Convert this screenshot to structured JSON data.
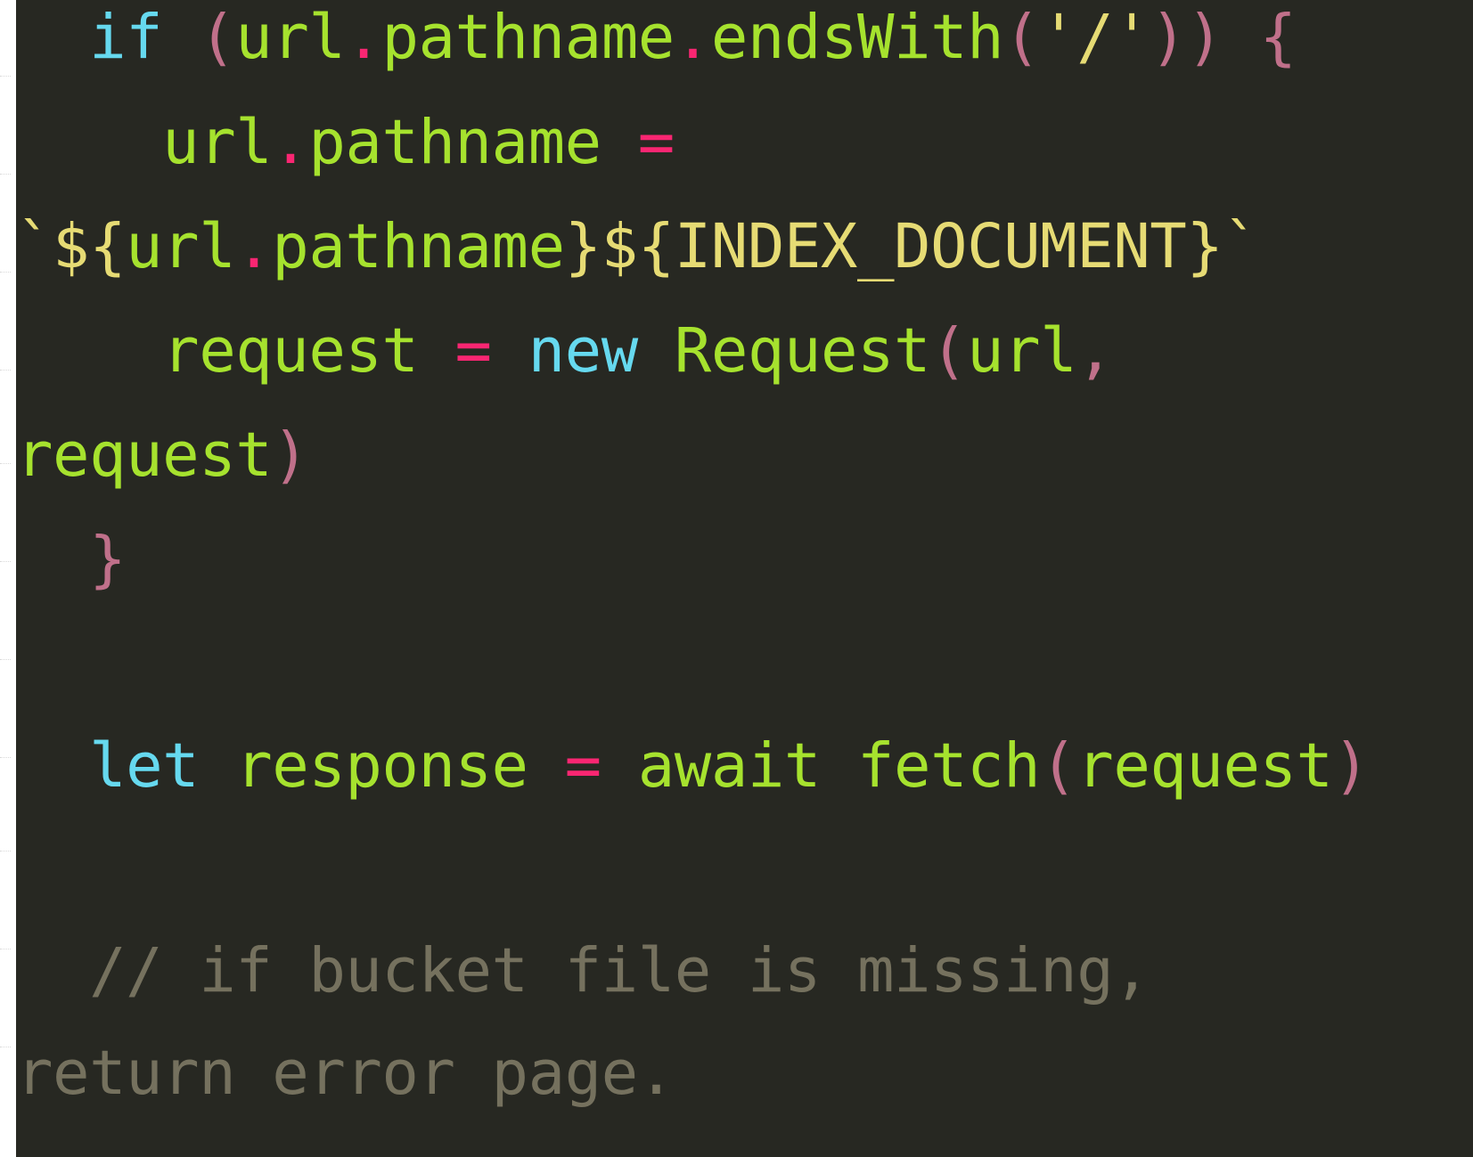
{
  "colors": {
    "background": "#272822",
    "keyword": "#66d9ef",
    "identifier": "#a6e22e",
    "punctuation": "#f92672",
    "paren": "#c0708a",
    "plain": "#f8f8f2",
    "string": "#e6db74",
    "comment": "#75715e"
  },
  "code": {
    "lines": [
      {
        "indent": "  ",
        "tokens": [
          {
            "text": "if",
            "kind": "keyword"
          },
          {
            "text": " ",
            "kind": "plain"
          },
          {
            "text": "(",
            "kind": "paren"
          },
          {
            "text": "url",
            "kind": "identifier"
          },
          {
            "text": ".",
            "kind": "punctuation"
          },
          {
            "text": "pathname",
            "kind": "identifier"
          },
          {
            "text": ".",
            "kind": "punctuation"
          },
          {
            "text": "endsWith",
            "kind": "identifier"
          },
          {
            "text": "(",
            "kind": "paren"
          },
          {
            "text": "'/'",
            "kind": "string"
          },
          {
            "text": ")) {",
            "kind": "paren"
          }
        ]
      },
      {
        "indent": "    ",
        "tokens": [
          {
            "text": "url",
            "kind": "identifier"
          },
          {
            "text": ".",
            "kind": "punctuation"
          },
          {
            "text": "pathname",
            "kind": "identifier"
          },
          {
            "text": " ",
            "kind": "plain"
          },
          {
            "text": "=",
            "kind": "punctuation"
          }
        ]
      },
      {
        "indent": "",
        "tokens": [
          {
            "text": "`${",
            "kind": "string"
          },
          {
            "text": "url",
            "kind": "identifier"
          },
          {
            "text": ".",
            "kind": "punctuation"
          },
          {
            "text": "pathname",
            "kind": "identifier"
          },
          {
            "text": "}${",
            "kind": "string"
          },
          {
            "text": "INDEX_DOCUMENT",
            "kind": "string"
          },
          {
            "text": "}`",
            "kind": "string"
          }
        ]
      },
      {
        "indent": "    ",
        "tokens": [
          {
            "text": "request",
            "kind": "identifier"
          },
          {
            "text": " ",
            "kind": "plain"
          },
          {
            "text": "=",
            "kind": "punctuation"
          },
          {
            "text": " ",
            "kind": "plain"
          },
          {
            "text": "new",
            "kind": "keyword"
          },
          {
            "text": " ",
            "kind": "plain"
          },
          {
            "text": "Request",
            "kind": "identifier"
          },
          {
            "text": "(",
            "kind": "paren"
          },
          {
            "text": "url",
            "kind": "identifier"
          },
          {
            "text": ",",
            "kind": "paren"
          }
        ]
      },
      {
        "indent": "",
        "tokens": [
          {
            "text": "request",
            "kind": "identifier"
          },
          {
            "text": ")",
            "kind": "paren"
          }
        ]
      },
      {
        "indent": "  ",
        "tokens": [
          {
            "text": "}",
            "kind": "paren"
          }
        ]
      },
      {
        "indent": "",
        "tokens": []
      },
      {
        "indent": "  ",
        "tokens": [
          {
            "text": "let",
            "kind": "keyword"
          },
          {
            "text": " ",
            "kind": "plain"
          },
          {
            "text": "response",
            "kind": "identifier"
          },
          {
            "text": " ",
            "kind": "plain"
          },
          {
            "text": "=",
            "kind": "punctuation"
          },
          {
            "text": " ",
            "kind": "plain"
          },
          {
            "text": "await",
            "kind": "identifier"
          },
          {
            "text": " ",
            "kind": "plain"
          },
          {
            "text": "fetch",
            "kind": "identifier"
          },
          {
            "text": "(",
            "kind": "paren"
          },
          {
            "text": "request",
            "kind": "identifier"
          },
          {
            "text": ")",
            "kind": "paren"
          }
        ]
      },
      {
        "indent": "",
        "tokens": []
      },
      {
        "indent": "  ",
        "tokens": [
          {
            "text": "// if bucket file is missing,",
            "kind": "comment"
          }
        ]
      },
      {
        "indent": "",
        "tokens": [
          {
            "text": "return error page.",
            "kind": "comment"
          }
        ]
      }
    ]
  }
}
